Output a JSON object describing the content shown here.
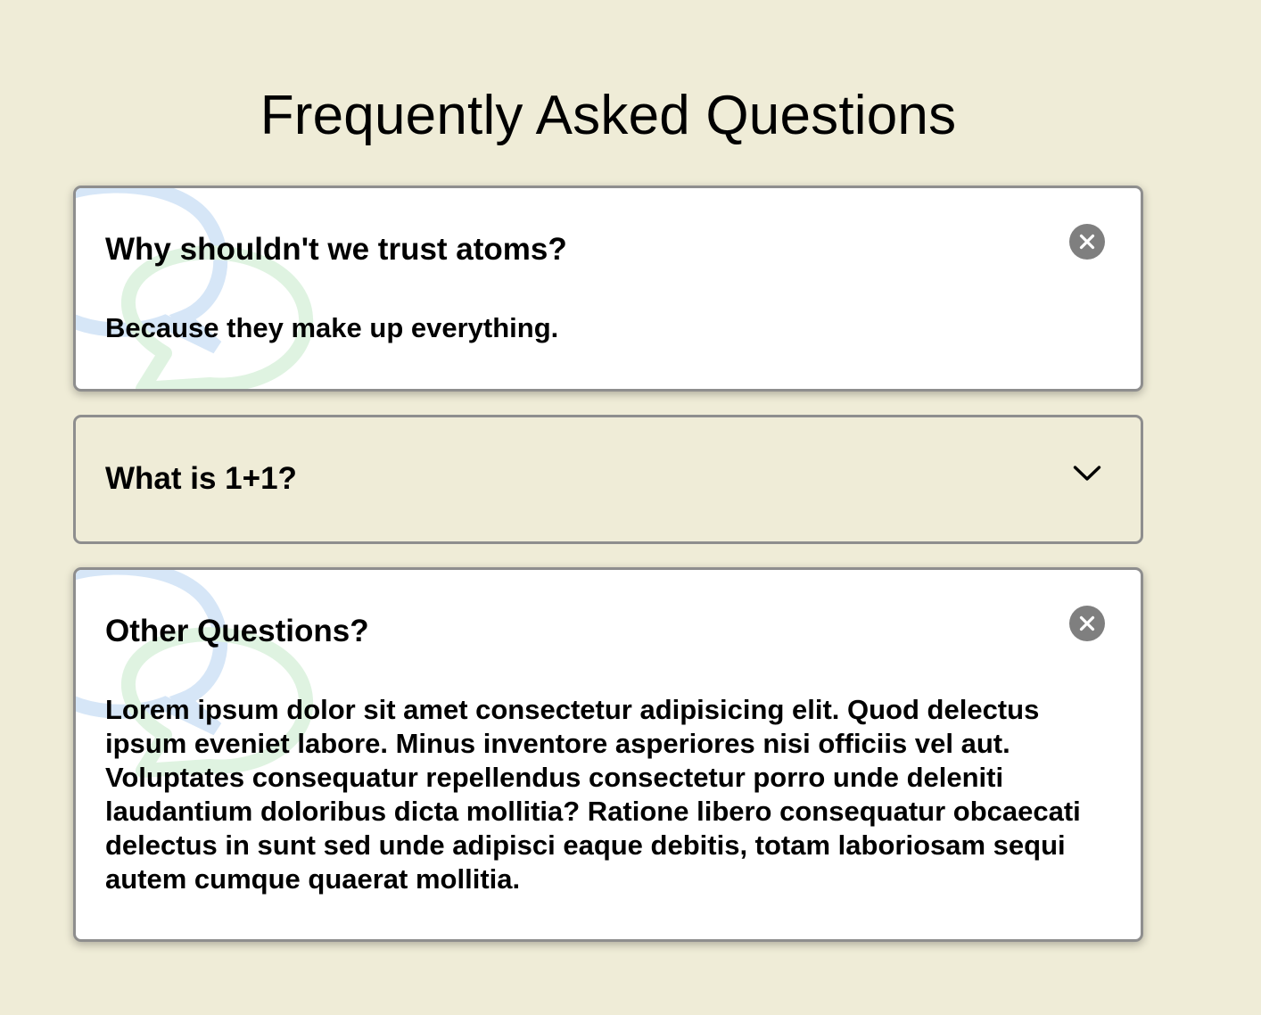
{
  "page": {
    "title": "Frequently Asked Questions"
  },
  "faqs": [
    {
      "question": "Why shouldn't we trust atoms?",
      "answer": "Because they make up everything.",
      "state": "open",
      "toggle_icon": "close-icon"
    },
    {
      "question": "What is 1+1?",
      "answer": "",
      "state": "closed",
      "toggle_icon": "chevron-down-icon"
    },
    {
      "question": "Other Questions?",
      "answer": "Lorem ipsum dolor sit amet consectetur adipisicing elit. Quod delectus ipsum eveniet labore. Minus inventore asperiores nisi officiis vel aut. Voluptates consequatur repellendus consectetur porro unde deleniti laudantium doloribus dicta mollitia? Ratione libero consequatur obcaecati delectus in sunt sed unde adipisci eaque debitis, totam laboriosam sequi autem cumque quaerat mollitia.",
      "state": "open",
      "toggle_icon": "close-icon"
    }
  ],
  "colors": {
    "background": "#efecd7",
    "card_open": "#ffffff",
    "card_border": "#8e8e8e",
    "close_button": "#7f7f7f",
    "bubble_blue": "#d6e6f7",
    "bubble_green": "#dff3e1"
  }
}
